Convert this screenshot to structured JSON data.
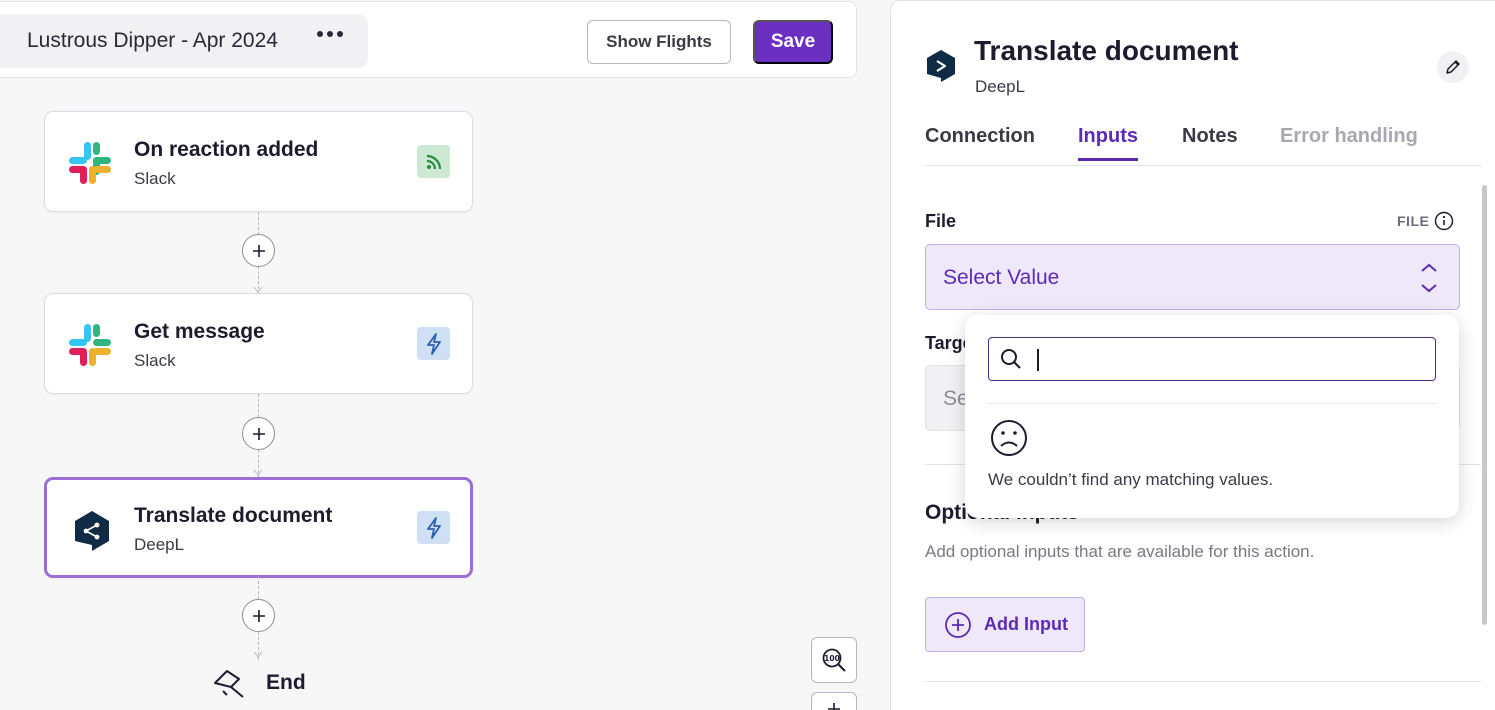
{
  "header": {
    "flow_name": "Lustrous Dipper - Apr 2024",
    "more_label": "•••",
    "show_flights_label": "Show Flights",
    "save_label": "Save"
  },
  "nodes": [
    {
      "title": "On reaction added",
      "subtitle": "Slack",
      "icon": "slack-logo-icon",
      "badge_icon": "rss-icon",
      "badge_color": "#cde8d3"
    },
    {
      "title": "Get message",
      "subtitle": "Slack",
      "icon": "slack-logo-icon",
      "badge_icon": "lightning-icon",
      "badge_color": "#cfe0f4"
    },
    {
      "title": "Translate document",
      "subtitle": "DeepL",
      "icon": "deepl-logo-icon",
      "badge_icon": "lightning-icon",
      "badge_color": "#cfe0f4",
      "selected": true
    }
  ],
  "end_label": "End",
  "panel": {
    "title": "Translate document",
    "subtitle": "DeepL",
    "tabs": [
      {
        "label": "Connection",
        "state": "normal"
      },
      {
        "label": "Inputs",
        "state": "active"
      },
      {
        "label": "Notes",
        "state": "normal"
      },
      {
        "label": "Error handling",
        "state": "disabled"
      }
    ],
    "file": {
      "label": "File",
      "type": "FILE",
      "placeholder": "Select Value"
    },
    "target": {
      "label": "Targe",
      "placeholder": "Se"
    },
    "optional": {
      "title": "Optional inputs",
      "description": "Add optional inputs that are available for this action.",
      "add_label": "Add Input"
    }
  },
  "dropdown": {
    "search_value": "",
    "empty_message": "We couldn’t find any matching values."
  },
  "colors": {
    "accent": "#6b2fc2",
    "accent_text": "#5b2bb5",
    "selected_border": "#9b6fd6"
  }
}
